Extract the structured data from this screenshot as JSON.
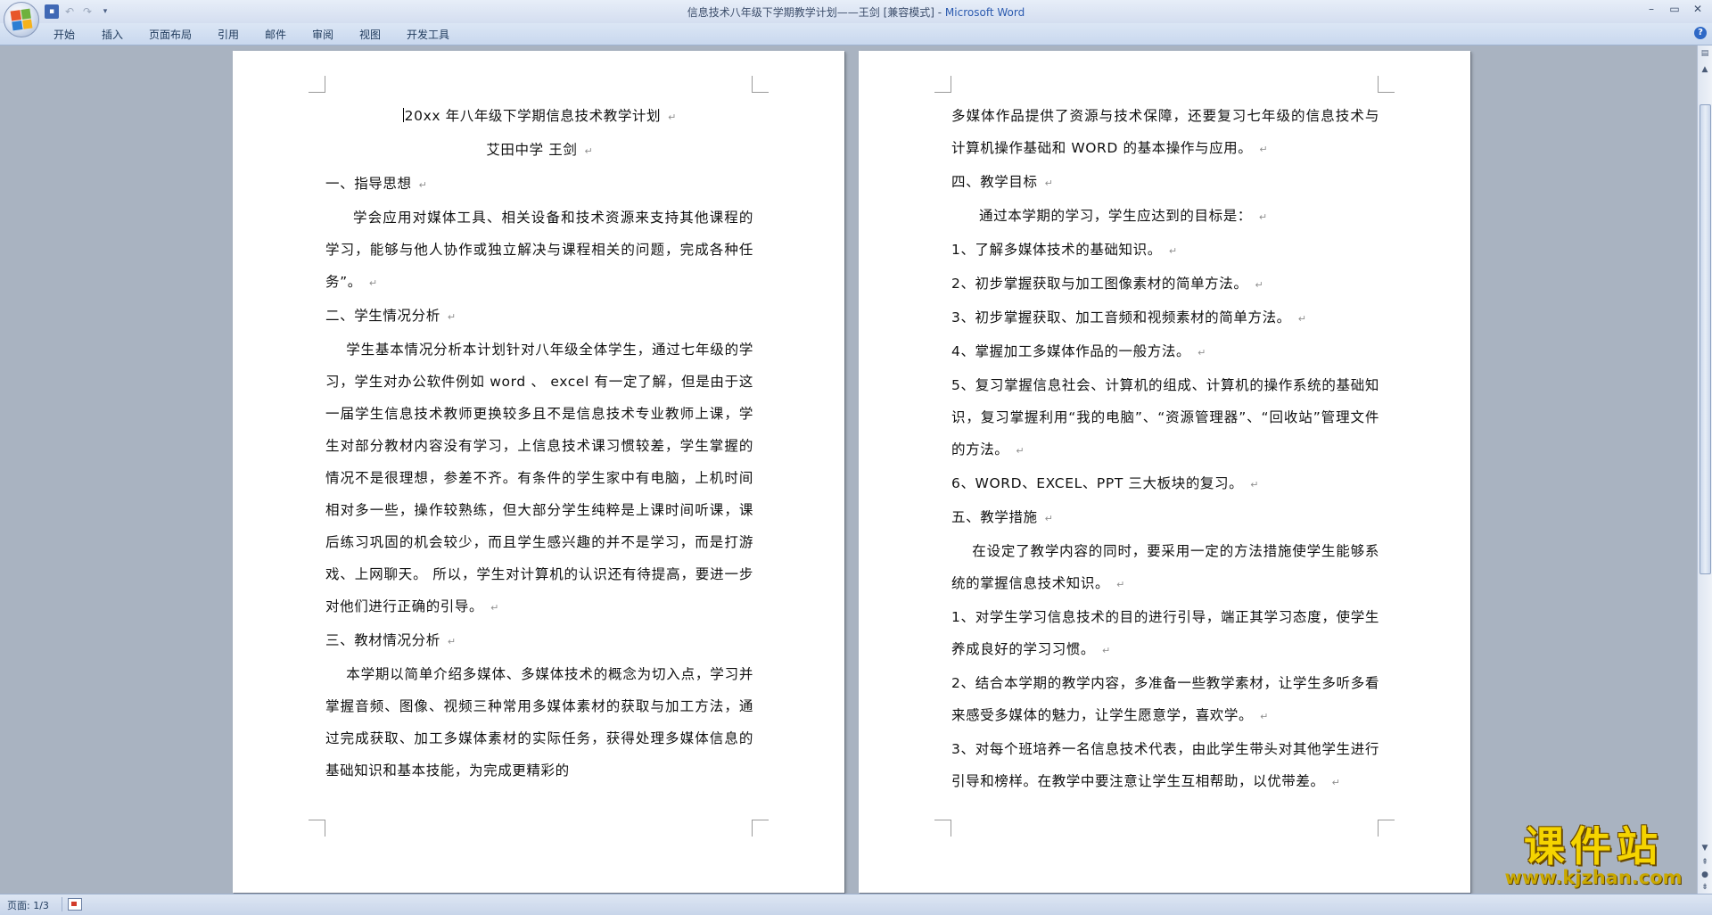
{
  "window": {
    "title_doc": "信息技术八年级下学期教学计划——王剑 [兼容模式] - ",
    "title_app": "Microsoft Word",
    "controls": [
      "–",
      "▭",
      "✕"
    ]
  },
  "qat": {
    "save": "▪",
    "undo": "↶",
    "redo": "↷",
    "customize": "▾"
  },
  "ribbon": {
    "tabs": [
      "开始",
      "插入",
      "页面布局",
      "引用",
      "邮件",
      "审阅",
      "视图",
      "开发工具"
    ],
    "help": "?"
  },
  "document": {
    "left_page": [
      {
        "text": "20xx 年八年级下学期信息技术教学计划",
        "style": "center"
      },
      {
        "text": "艾田中学  王剑",
        "style": "center"
      },
      {
        "text": "一、指导思想",
        "style": "heading"
      },
      {
        "text": "学会应用对媒体工具、相关设备和技术资源来支持其他课程的学习，能够与他人协作或独立解决与课程相关的问题，完成各种任务”。",
        "style": "indent"
      },
      {
        "text": "二、学生情况分析",
        "style": "heading"
      },
      {
        "text": "学生基本情况分析本计划针对八年级全体学生，通过七年级的学习，学生对办公软件例如 word 、 excel 有一定了解，但是由于这一届学生信息技术教师更换较多且不是信息技术专业教师上课，学生对部分教材内容没有学习，上信息技术课习惯较差，学生掌握的情况不是很理想，参差不齐。有条件的学生家中有电脑，上机时间相对多一些，操作较熟练，但大部分学生纯粹是上课时间听课，课后练习巩固的机会较少，而且学生感兴趣的并不是学习，而是打游戏、上网聊天。 所以，学生对计算机的认识还有待提高，要进一步对他们进行正确的引导。",
        "style": "indent1"
      },
      {
        "text": "三、教材情况分析",
        "style": "heading"
      },
      {
        "text": "本学期以简单介绍多媒体、多媒体技术的概念为切入点，学习并掌握音频、图像、视频三种常用多媒体素材的获取与加工方法，通过完成获取、加工多媒体素材的实际任务，获得处理多媒体信息的基础知识和基本技能，为完成更精彩的",
        "style": "indent1",
        "no_mark": true
      }
    ],
    "right_page": [
      {
        "text": "多媒体作品提供了资源与技术保障，还要复习七年级的信息技术与计算机操作基础和 WORD 的基本操作与应用。",
        "style": "plain"
      },
      {
        "text": "四、教学目标",
        "style": "heading"
      },
      {
        "text": "通过本学期的学习，学生应达到的目标是：",
        "style": "indent"
      },
      {
        "text": "1、了解多媒体技术的基础知识。",
        "style": "plain"
      },
      {
        "text": "2、初步掌握获取与加工图像素材的简单方法。",
        "style": "plain"
      },
      {
        "text": "3、初步掌握获取、加工音频和视频素材的简单方法。",
        "style": "plain"
      },
      {
        "text": "4、掌握加工多媒体作品的一般方法。",
        "style": "plain"
      },
      {
        "text": "5、复习掌握信息社会、计算机的组成、计算机的操作系统的基础知识，复习掌握利用“我的电脑”、“资源管理器”、“回收站”管理文件的方法。",
        "style": "plain"
      },
      {
        "text": "6、WORD、EXCEL、PPT 三大板块的复习。",
        "style": "plain"
      },
      {
        "text": "五、教学措施",
        "style": "heading"
      },
      {
        "text": "在设定了教学内容的同时，要采用一定的方法措施使学生能够系统的掌握信息技术知识。",
        "style": "indent1"
      },
      {
        "text": "1、对学生学习信息技术的目的进行引导，端正其学习态度，使学生养成良好的学习习惯。",
        "style": "plain"
      },
      {
        "text": "2、结合本学期的教学内容，多准备一些教学素材，让学生多听多看来感受多媒体的魅力，让学生愿意学，喜欢学。",
        "style": "plain"
      },
      {
        "text": "3、对每个班培养一名信息技术代表，由此学生带头对其他学生进行引导和榜样。在教学中要注意让学生互相帮助，以优带差。",
        "style": "plain"
      }
    ],
    "paragraph_mark": "↵"
  },
  "statusbar": {
    "page_label": "页面: 1/3"
  },
  "watermark": {
    "cn": "课件站",
    "url": "www.kjzhan.com"
  }
}
